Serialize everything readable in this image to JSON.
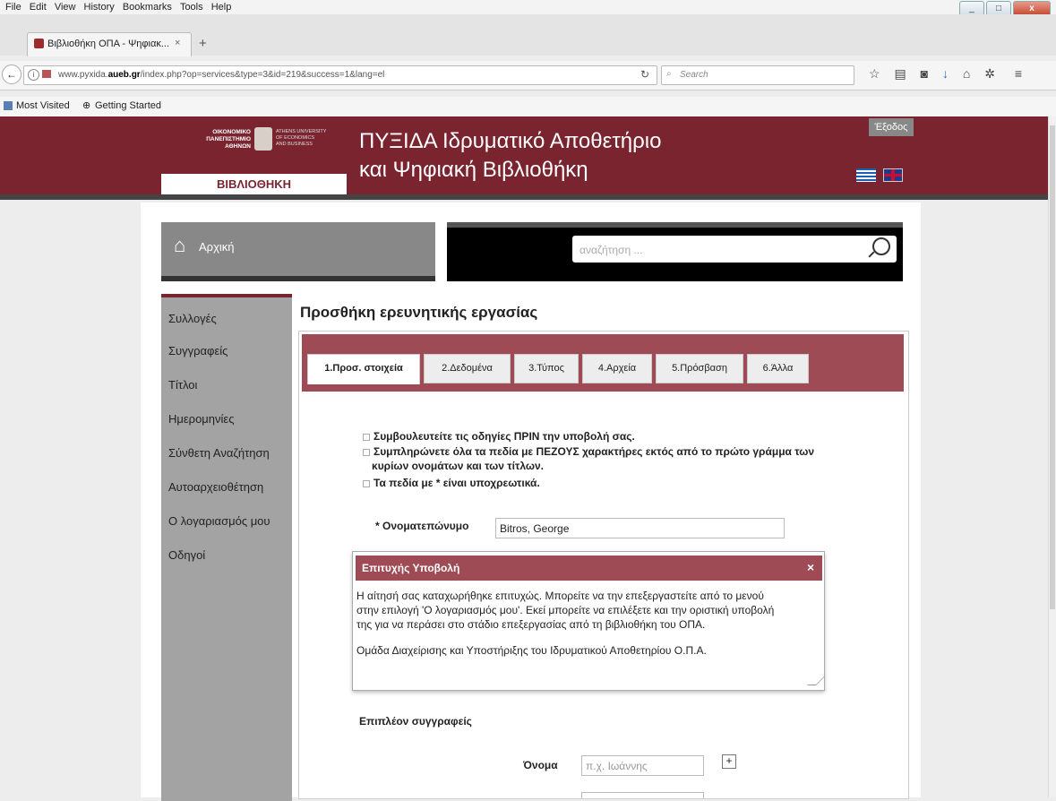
{
  "browser": {
    "menu": [
      "File",
      "Edit",
      "View",
      "History",
      "Bookmarks",
      "Tools",
      "Help"
    ],
    "tab_title": "Βιβλιοθήκη ΟΠΑ - Ψηφιακ...",
    "url_prefix": "www.pyxida.",
    "url_domain": "aueb.gr",
    "url_path": "/index.php?op=services&type=3&id=219&success=1&lang=el",
    "search_placeholder": "Search",
    "bookmarks": [
      "Most Visited",
      "Getting Started"
    ]
  },
  "header": {
    "logo_gr": [
      "ΟΙΚΟΝΟΜΙΚΟ",
      "ΠΑΝΕΠΙΣΤΗΜΙΟ",
      "ΑΘΗΝΩΝ"
    ],
    "logo_en": [
      "ATHENS UNIVERSITY",
      "OF ECONOMICS",
      "AND BUSINESS"
    ],
    "library_label": "ΒΙΒΛΙΟΘΗΚΗ",
    "title_line1": "ΠΥΞΙΔΑ Ιδρυματικό Αποθετήριο",
    "title_line2": "και Ψηφιακή Βιβλιοθήκη",
    "logout": "Έξοδος"
  },
  "home": {
    "label": "Αρχική"
  },
  "site_search": {
    "placeholder": "αναζήτηση ..."
  },
  "sidebar": {
    "items": [
      "Συλλογές",
      "Συγγραφείς",
      "Τίτλοι",
      "Ημερομηνίες",
      "Σύνθετη Αναζήτηση",
      "Αυτοαρχειοθέτηση",
      "Ο λογαριασμός μου",
      "Οδηγοί"
    ]
  },
  "main": {
    "title": "Προσθήκη ερευνητικής εργασίας",
    "tabs": [
      "1.Προσ. στοιχεία",
      "2.Δεδομένα",
      "3.Τύπος",
      "4.Αρχεία",
      "5.Πρόσβαση",
      "6.Άλλα"
    ],
    "notes": [
      "Συμβουλευτείτε τις οδηγίες ΠΡΙΝ την υποβολή σας.",
      "Συμπληρώνετε όλα τα πεδία με ΠΕΖΟΥΣ χαρακτήρες εκτός από το πρώτο γράμμα των",
      "κυρίων ονομάτων και των τίτλων.",
      "Τα πεδία με * είναι υποχρεωτικά."
    ],
    "name_label": "* Ονοματεπώνυμο",
    "name_value": "Bitros, George",
    "more_authors": "Επιπλέον συγγραφείς",
    "first_name_label": "Όνομα",
    "first_name_placeholder": "π.χ. Ιωάννης",
    "plus": "+"
  },
  "dialog": {
    "title": "Επιτυχής Υποβολή",
    "close": "×",
    "line1": "Η αίτησή σας καταχωρήθηκε επιτυχώς. Μπορείτε να την επεξεργαστείτε από το μενού",
    "line2": "στην επιλογή 'Ο λογαριασμός μου'. Εκεί μπορείτε να επιλέξετε και την οριστική υποβολή",
    "line3": "της για να περάσει στο στάδιο επεξεργασίας από τη βιβλιοθήκη του ΟΠΑ.",
    "signature": "Ομάδα Διαχείρισης και Υποστήριξης του Ιδρυματικού Αποθετηρίου Ο.Π.Α."
  }
}
